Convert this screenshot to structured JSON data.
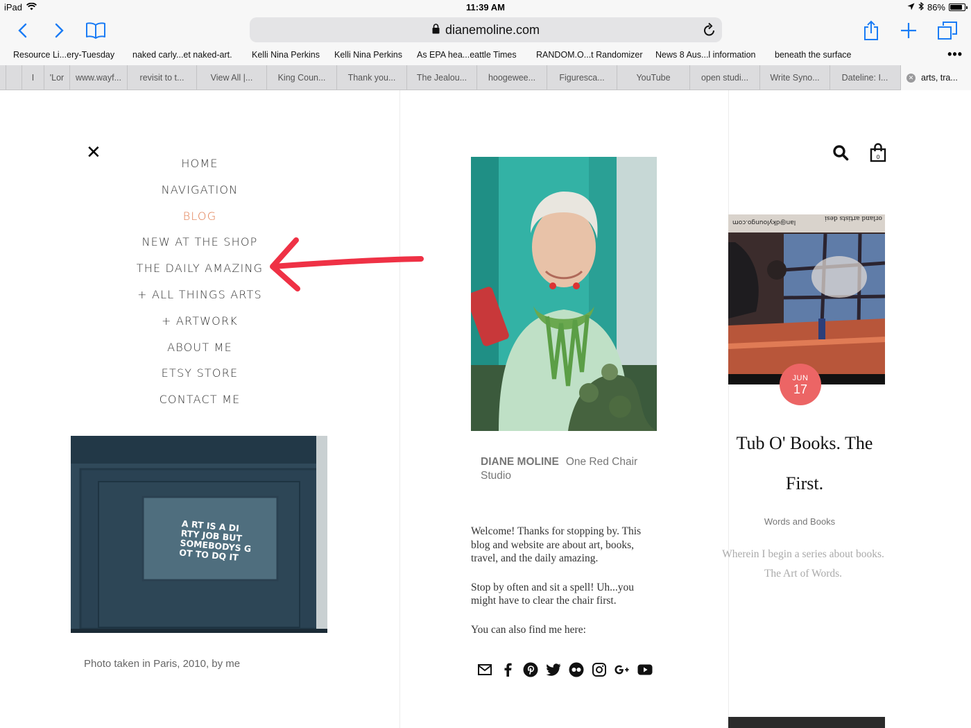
{
  "status_bar": {
    "device": "iPad",
    "time": "11:39 AM",
    "battery": "86%",
    "battery_level": 0.86
  },
  "browser": {
    "url": "dianemoline.com",
    "favorites": [
      "Resource Li...ery-Tuesday",
      "naked carly...et naked-art.",
      "Kelli Nina Perkins",
      "Kelli Nina Perkins",
      "As EPA hea...eattle Times",
      "RANDOM.O...t Randomizer",
      "News 8 Aus...l information",
      "beneath the surface"
    ],
    "more": "•••",
    "tabs": [
      "I",
      "'Lor",
      "www.wayf...",
      "revisit to t...",
      "View All |...",
      "King Coun...",
      "Thank you...",
      "The Jealou...",
      "hoogewee...",
      "Figuresca...",
      "YouTube",
      "open studi...",
      "Write Syno...",
      "Dateline: I..."
    ],
    "active_tab": "arts, tra..."
  },
  "menu": {
    "items": [
      "HOME",
      "NAVIGATION",
      "BLOG",
      "NEW AT THE SHOP",
      "THE DAILY AMAZING",
      "+ ALL THINGS ARTS",
      "+ ARTWORK",
      "ABOUT ME",
      "ETSY STORE",
      "CONTACT ME"
    ],
    "active_index": 2,
    "active_color": "#e0794b"
  },
  "left_column": {
    "photo_sign_text": [
      "A RT IS A DI",
      "RTY JOB BUT",
      "SOMEBODYS G",
      "OT TO DQ IT"
    ],
    "caption": "Photo taken in Paris, 2010, by me"
  },
  "middle_column": {
    "site_name": "DIANE MOLINE",
    "site_subtitle": "One Red Chair Studio",
    "welcome": [
      "Welcome! Thanks for stopping by.  This blog and website are about art, books, travel, and the daily amazing.",
      "Stop by often and sit a spell! Uh...you might have to clear the chair first.",
      "You can also find me here:"
    ],
    "social_icons": [
      "email-icon",
      "facebook-icon",
      "pinterest-icon",
      "twitter-icon",
      "flickr-icon",
      "instagram-icon",
      "google-plus-icon",
      "youtube-icon"
    ]
  },
  "right_column": {
    "image_text_top": "lan@dkyloungo.com",
    "image_text_side": "orland artists desi",
    "date_month": "JUN",
    "date_day": "17",
    "post_title_line1": "Tub O' Books. The",
    "post_title_line2": "First.",
    "category": "Words and Books",
    "excerpt": "Wherein I begin a series about books. The Art of Words.",
    "badge_color": "#ec6565"
  },
  "colors": {
    "ios_blue": "#1a7cf5",
    "arrow_red": "#ef3145"
  }
}
